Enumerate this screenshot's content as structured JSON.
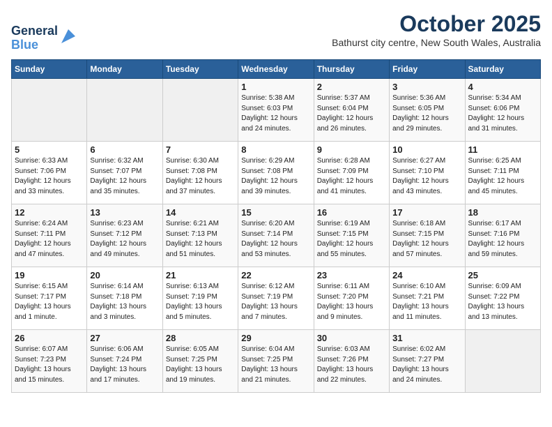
{
  "logo": {
    "line1": "General",
    "line2": "Blue"
  },
  "title": "October 2025",
  "subtitle": "Bathurst city centre, New South Wales, Australia",
  "days_header": [
    "Sunday",
    "Monday",
    "Tuesday",
    "Wednesday",
    "Thursday",
    "Friday",
    "Saturday"
  ],
  "weeks": [
    [
      {
        "day": "",
        "info": ""
      },
      {
        "day": "",
        "info": ""
      },
      {
        "day": "",
        "info": ""
      },
      {
        "day": "1",
        "info": "Sunrise: 5:38 AM\nSunset: 6:03 PM\nDaylight: 12 hours\nand 24 minutes."
      },
      {
        "day": "2",
        "info": "Sunrise: 5:37 AM\nSunset: 6:04 PM\nDaylight: 12 hours\nand 26 minutes."
      },
      {
        "day": "3",
        "info": "Sunrise: 5:36 AM\nSunset: 6:05 PM\nDaylight: 12 hours\nand 29 minutes."
      },
      {
        "day": "4",
        "info": "Sunrise: 5:34 AM\nSunset: 6:06 PM\nDaylight: 12 hours\nand 31 minutes."
      }
    ],
    [
      {
        "day": "5",
        "info": "Sunrise: 6:33 AM\nSunset: 7:06 PM\nDaylight: 12 hours\nand 33 minutes."
      },
      {
        "day": "6",
        "info": "Sunrise: 6:32 AM\nSunset: 7:07 PM\nDaylight: 12 hours\nand 35 minutes."
      },
      {
        "day": "7",
        "info": "Sunrise: 6:30 AM\nSunset: 7:08 PM\nDaylight: 12 hours\nand 37 minutes."
      },
      {
        "day": "8",
        "info": "Sunrise: 6:29 AM\nSunset: 7:08 PM\nDaylight: 12 hours\nand 39 minutes."
      },
      {
        "day": "9",
        "info": "Sunrise: 6:28 AM\nSunset: 7:09 PM\nDaylight: 12 hours\nand 41 minutes."
      },
      {
        "day": "10",
        "info": "Sunrise: 6:27 AM\nSunset: 7:10 PM\nDaylight: 12 hours\nand 43 minutes."
      },
      {
        "day": "11",
        "info": "Sunrise: 6:25 AM\nSunset: 7:11 PM\nDaylight: 12 hours\nand 45 minutes."
      }
    ],
    [
      {
        "day": "12",
        "info": "Sunrise: 6:24 AM\nSunset: 7:11 PM\nDaylight: 12 hours\nand 47 minutes."
      },
      {
        "day": "13",
        "info": "Sunrise: 6:23 AM\nSunset: 7:12 PM\nDaylight: 12 hours\nand 49 minutes."
      },
      {
        "day": "14",
        "info": "Sunrise: 6:21 AM\nSunset: 7:13 PM\nDaylight: 12 hours\nand 51 minutes."
      },
      {
        "day": "15",
        "info": "Sunrise: 6:20 AM\nSunset: 7:14 PM\nDaylight: 12 hours\nand 53 minutes."
      },
      {
        "day": "16",
        "info": "Sunrise: 6:19 AM\nSunset: 7:15 PM\nDaylight: 12 hours\nand 55 minutes."
      },
      {
        "day": "17",
        "info": "Sunrise: 6:18 AM\nSunset: 7:15 PM\nDaylight: 12 hours\nand 57 minutes."
      },
      {
        "day": "18",
        "info": "Sunrise: 6:17 AM\nSunset: 7:16 PM\nDaylight: 12 hours\nand 59 minutes."
      }
    ],
    [
      {
        "day": "19",
        "info": "Sunrise: 6:15 AM\nSunset: 7:17 PM\nDaylight: 13 hours\nand 1 minute."
      },
      {
        "day": "20",
        "info": "Sunrise: 6:14 AM\nSunset: 7:18 PM\nDaylight: 13 hours\nand 3 minutes."
      },
      {
        "day": "21",
        "info": "Sunrise: 6:13 AM\nSunset: 7:19 PM\nDaylight: 13 hours\nand 5 minutes."
      },
      {
        "day": "22",
        "info": "Sunrise: 6:12 AM\nSunset: 7:19 PM\nDaylight: 13 hours\nand 7 minutes."
      },
      {
        "day": "23",
        "info": "Sunrise: 6:11 AM\nSunset: 7:20 PM\nDaylight: 13 hours\nand 9 minutes."
      },
      {
        "day": "24",
        "info": "Sunrise: 6:10 AM\nSunset: 7:21 PM\nDaylight: 13 hours\nand 11 minutes."
      },
      {
        "day": "25",
        "info": "Sunrise: 6:09 AM\nSunset: 7:22 PM\nDaylight: 13 hours\nand 13 minutes."
      }
    ],
    [
      {
        "day": "26",
        "info": "Sunrise: 6:07 AM\nSunset: 7:23 PM\nDaylight: 13 hours\nand 15 minutes."
      },
      {
        "day": "27",
        "info": "Sunrise: 6:06 AM\nSunset: 7:24 PM\nDaylight: 13 hours\nand 17 minutes."
      },
      {
        "day": "28",
        "info": "Sunrise: 6:05 AM\nSunset: 7:25 PM\nDaylight: 13 hours\nand 19 minutes."
      },
      {
        "day": "29",
        "info": "Sunrise: 6:04 AM\nSunset: 7:25 PM\nDaylight: 13 hours\nand 21 minutes."
      },
      {
        "day": "30",
        "info": "Sunrise: 6:03 AM\nSunset: 7:26 PM\nDaylight: 13 hours\nand 22 minutes."
      },
      {
        "day": "31",
        "info": "Sunrise: 6:02 AM\nSunset: 7:27 PM\nDaylight: 13 hours\nand 24 minutes."
      },
      {
        "day": "",
        "info": ""
      }
    ]
  ]
}
